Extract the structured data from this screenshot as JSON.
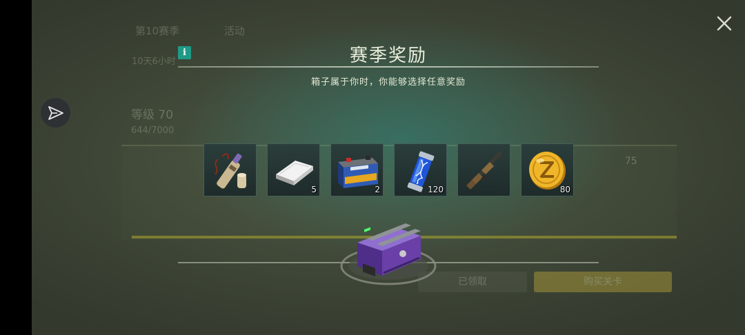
{
  "background": {
    "tabs": [
      "第10赛季",
      "活动"
    ],
    "timer": "10天6小时",
    "level": "等级 70",
    "exp": "644/7000",
    "rank_value": "75",
    "bg_buttons": [
      "已领取",
      "购买关卡"
    ]
  },
  "modal": {
    "title": "赛季奖励",
    "subtitle": "箱子属于你时，你能够选择任意奖励",
    "info_icon_glyph": "i",
    "close_glyph": "×"
  },
  "rewards": [
    {
      "name": "scroll-bundle",
      "icon": "scroll-icon",
      "count": ""
    },
    {
      "name": "silver-bar",
      "icon": "silver-bar-icon",
      "count": "5"
    },
    {
      "name": "car-battery",
      "icon": "battery-icon",
      "count": "2"
    },
    {
      "name": "dna-capsule",
      "icon": "dna-capsule-icon",
      "count": "120"
    },
    {
      "name": "assault-rifle",
      "icon": "rifle-icon",
      "count": ""
    },
    {
      "name": "gold-coin",
      "icon": "gold-coin-icon",
      "count": "80"
    }
  ],
  "chest": {
    "icon": "purple-chest-icon"
  },
  "colors": {
    "accent_teal": "#1f9a86",
    "chest_purple": "#6a3fa8",
    "coin_gold": "#e0a21a"
  }
}
